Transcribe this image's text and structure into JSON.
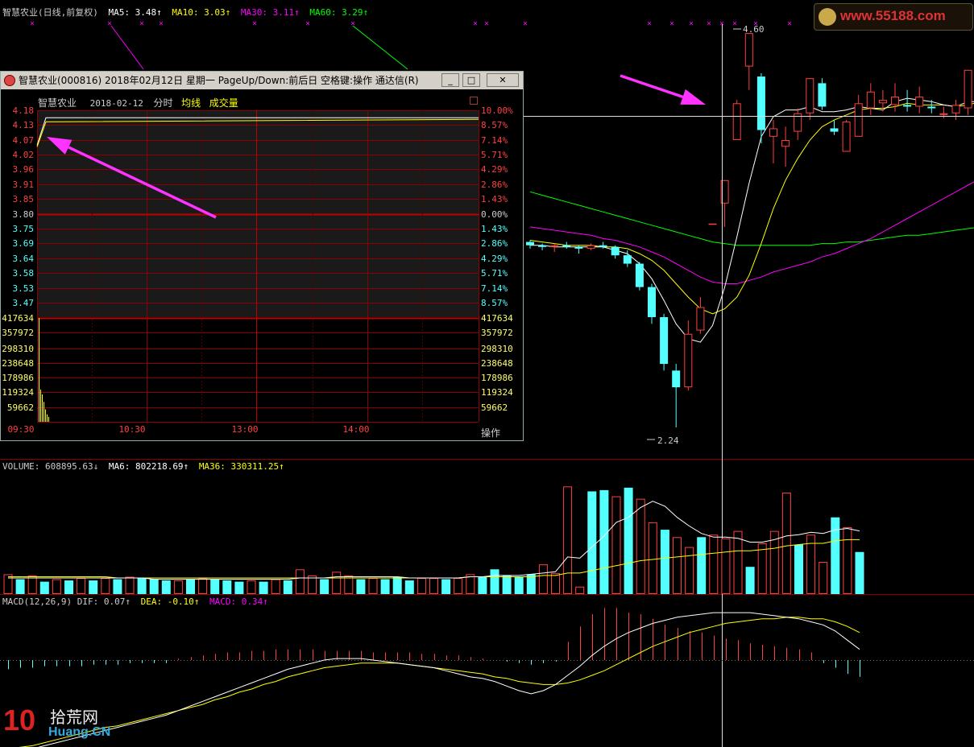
{
  "main": {
    "legend_title": "智慧农业(日线,前复权)",
    "ma5": "MA5: 3.48↑",
    "ma10": "MA10: 3.03↑",
    "ma30": "MA30: 3.11↑",
    "ma60": "MA60: 3.29↑",
    "high_label": "4.60",
    "low_label": "2.24"
  },
  "volume_panel": {
    "label": "VOLUME: 608895.63↓",
    "ma6": "MA6: 802218.69↑",
    "ma36": "MA36: 330311.25↑"
  },
  "macd_panel": {
    "label": "MACD(12,26,9) DIF: 0.07↑",
    "dea": "DEA: -0.10↑",
    "macd": "MACD: 0.34↑"
  },
  "popup": {
    "window_title": "智慧农业(000816) 2018年02月12日 星期一 PageUp/Down:前后日 空格键:操作 通达信(R)",
    "stock_name": "智慧农业",
    "date": "2018-02-12",
    "mode": "分时",
    "avg_line": "均线",
    "volume_label": "成交量",
    "price_ticks": [
      "4.18",
      "4.13",
      "4.07",
      "4.02",
      "3.96",
      "3.91",
      "3.85",
      "3.80",
      "3.75",
      "3.69",
      "3.64",
      "3.58",
      "3.53",
      "3.47"
    ],
    "pct_ticks": [
      "10.00%",
      "8.57%",
      "7.14%",
      "5.71%",
      "4.29%",
      "2.86%",
      "1.43%",
      "0.00%",
      "1.43%",
      "2.86%",
      "4.29%",
      "5.71%",
      "7.14%",
      "8.57%"
    ],
    "vol_ticks": [
      "417634",
      "357972",
      "298310",
      "238648",
      "178986",
      "119324",
      "59662"
    ],
    "time_ticks": [
      "09:30",
      "10:30",
      "13:00",
      "14:00"
    ],
    "action_button": "操作",
    "btn_min": "_",
    "btn_max": "□",
    "btn_close": "✕"
  },
  "watermarks": {
    "top_right": "www.55188.com",
    "bottom_left_cn": "拾荒网",
    "bottom_left_num": "10",
    "bottom_left_en": "Huang.CN"
  },
  "colors": {
    "up": "#ff4040",
    "down": "#54ffff",
    "ma5": "#ffffff",
    "ma10": "#ffff00",
    "ma30": "#ff00ff",
    "ma60": "#00ff00",
    "popup_grid": "#8b0000"
  },
  "chart_data": {
    "type": "candlestick",
    "title": "智慧农业(日线,前复权)",
    "candles": [
      {
        "o": 3.35,
        "h": 3.36,
        "l": 3.31,
        "c": 3.33
      },
      {
        "o": 3.33,
        "h": 3.34,
        "l": 3.3,
        "c": 3.32
      },
      {
        "o": 3.32,
        "h": 3.34,
        "l": 3.29,
        "c": 3.33
      },
      {
        "o": 3.33,
        "h": 3.35,
        "l": 3.31,
        "c": 3.32
      },
      {
        "o": 3.32,
        "h": 3.33,
        "l": 3.28,
        "c": 3.31
      },
      {
        "o": 3.31,
        "h": 3.34,
        "l": 3.3,
        "c": 3.33
      },
      {
        "o": 3.33,
        "h": 3.35,
        "l": 3.31,
        "c": 3.32
      },
      {
        "o": 3.32,
        "h": 3.33,
        "l": 3.25,
        "c": 3.27
      },
      {
        "o": 3.27,
        "h": 3.3,
        "l": 3.2,
        "c": 3.22
      },
      {
        "o": 3.22,
        "h": 3.23,
        "l": 3.06,
        "c": 3.08
      },
      {
        "o": 3.08,
        "h": 3.1,
        "l": 2.86,
        "c": 2.9
      },
      {
        "o": 2.9,
        "h": 2.92,
        "l": 2.58,
        "c": 2.62
      },
      {
        "o": 2.58,
        "h": 2.62,
        "l": 2.24,
        "c": 2.48
      },
      {
        "o": 2.48,
        "h": 2.88,
        "l": 2.46,
        "c": 2.8
      },
      {
        "o": 2.82,
        "h": 3.02,
        "l": 2.8,
        "c": 2.96
      },
      {
        "o": 3.46,
        "h": 3.46,
        "l": 3.46,
        "c": 3.46
      },
      {
        "o": 3.58,
        "h": 3.72,
        "l": 3.44,
        "c": 3.72
      },
      {
        "o": 3.96,
        "h": 4.2,
        "l": 3.96,
        "c": 4.18
      },
      {
        "o": 4.4,
        "h": 4.6,
        "l": 4.26,
        "c": 4.6
      },
      {
        "o": 4.34,
        "h": 4.36,
        "l": 3.94,
        "c": 4.02
      },
      {
        "o": 3.98,
        "h": 4.08,
        "l": 3.82,
        "c": 4.03
      },
      {
        "o": 3.92,
        "h": 4.04,
        "l": 3.8,
        "c": 3.96
      },
      {
        "o": 4.01,
        "h": 4.15,
        "l": 3.96,
        "c": 4.12
      },
      {
        "o": 4.12,
        "h": 4.33,
        "l": 4.08,
        "c": 4.33
      },
      {
        "o": 4.3,
        "h": 4.33,
        "l": 4.14,
        "c": 4.16
      },
      {
        "o": 4.03,
        "h": 4.08,
        "l": 3.99,
        "c": 4.01
      },
      {
        "o": 3.89,
        "h": 4.08,
        "l": 3.89,
        "c": 4.07
      },
      {
        "o": 3.98,
        "h": 4.23,
        "l": 3.98,
        "c": 4.18
      },
      {
        "o": 4.15,
        "h": 4.3,
        "l": 4.11,
        "c": 4.25
      },
      {
        "o": 4.18,
        "h": 4.26,
        "l": 4.13,
        "c": 4.2
      },
      {
        "o": 4.17,
        "h": 4.3,
        "l": 4.13,
        "c": 4.22
      },
      {
        "o": 4.17,
        "h": 4.26,
        "l": 4.13,
        "c": 4.16
      },
      {
        "o": 4.16,
        "h": 4.28,
        "l": 4.12,
        "c": 4.22
      },
      {
        "o": 4.16,
        "h": 4.2,
        "l": 4.12,
        "c": 4.15
      },
      {
        "o": 4.11,
        "h": 4.16,
        "l": 4.09,
        "c": 4.12
      },
      {
        "o": 4.12,
        "h": 4.2,
        "l": 4.08,
        "c": 4.17
      },
      {
        "o": 4.15,
        "h": 4.38,
        "l": 4.11,
        "c": 4.38
      },
      {
        "o": 4.22,
        "h": 4.28,
        "l": 4.12,
        "c": 4.18
      },
      {
        "o": 4.16,
        "h": 4.18,
        "l": 3.94,
        "c": 3.98
      },
      {
        "o": 3.96,
        "h": 4.0,
        "l": 3.86,
        "c": 3.98
      },
      {
        "o": 3.98,
        "h": 3.98,
        "l": 3.88,
        "c": 3.92
      }
    ],
    "ma5": [
      3.33,
      3.33,
      3.32,
      3.32,
      3.32,
      3.32,
      3.32,
      3.3,
      3.28,
      3.22,
      3.13,
      3.0,
      2.86,
      2.77,
      2.75,
      2.85,
      3.08,
      3.38,
      3.7,
      3.98,
      4.1,
      4.14,
      4.14,
      4.16,
      4.13,
      4.13,
      4.14,
      4.16,
      4.15,
      4.14,
      4.19,
      4.21,
      4.2,
      4.19,
      4.17,
      4.16,
      4.19,
      4.19,
      4.16,
      4.11,
      4.05
    ],
    "ma10": [
      3.36,
      3.35,
      3.34,
      3.33,
      3.33,
      3.33,
      3.32,
      3.32,
      3.31,
      3.28,
      3.24,
      3.18,
      3.1,
      3.02,
      2.95,
      2.92,
      2.95,
      3.02,
      3.15,
      3.34,
      3.55,
      3.72,
      3.85,
      3.96,
      4.04,
      4.08,
      4.11,
      4.14,
      4.15,
      4.15,
      4.16,
      4.18,
      4.17,
      4.17,
      4.17,
      4.16,
      4.17,
      4.19,
      4.18,
      4.16,
      4.12
    ],
    "ma30": [
      3.44,
      3.43,
      3.42,
      3.41,
      3.4,
      3.39,
      3.37,
      3.36,
      3.34,
      3.32,
      3.29,
      3.26,
      3.22,
      3.18,
      3.14,
      3.11,
      3.1,
      3.1,
      3.12,
      3.14,
      3.17,
      3.19,
      3.21,
      3.23,
      3.26,
      3.28,
      3.31,
      3.34,
      3.37,
      3.41,
      3.45,
      3.49,
      3.53,
      3.57,
      3.61,
      3.65,
      3.69,
      3.73,
      3.77,
      3.81,
      3.84
    ],
    "ma60": [
      3.65,
      3.63,
      3.61,
      3.59,
      3.57,
      3.55,
      3.53,
      3.51,
      3.49,
      3.47,
      3.45,
      3.43,
      3.41,
      3.39,
      3.37,
      3.35,
      3.34,
      3.33,
      3.33,
      3.33,
      3.33,
      3.33,
      3.33,
      3.33,
      3.34,
      3.34,
      3.35,
      3.35,
      3.36,
      3.37,
      3.38,
      3.39,
      3.39,
      3.4,
      3.41,
      3.42,
      3.43,
      3.44,
      3.45,
      3.46,
      3.47
    ],
    "volume": [
      1.6,
      1.2,
      1.5,
      1.0,
      1.2,
      1.1,
      1.3,
      1.1,
      1.3,
      1.2,
      1.4,
      1.3,
      1.2,
      1.1,
      1.1,
      1.2,
      1.3,
      1.2,
      1.1,
      1.0,
      1.1,
      1.0,
      1.2,
      1.1,
      2.0,
      1.5,
      1.2,
      1.8,
      1.5,
      1.2,
      1.3,
      1.2,
      1.4,
      1.1,
      1.3,
      1.3,
      1.2,
      1.3,
      1.6,
      1.4,
      2.0,
      1.5,
      1.4,
      1.6,
      2.4,
      1.7,
      8.7,
      0.6,
      8.3,
      8.4,
      7.9,
      8.6,
      7.7,
      5.8,
      5.2,
      4.6,
      3.8,
      4.6,
      4.8,
      4.5,
      5.1,
      2.2,
      4.1,
      5.1,
      8.2,
      4.0,
      4.8,
      2.6,
      6.2,
      5.4,
      3.4
    ],
    "volume_scale_note": "",
    "vol_ma6": [
      1.3,
      1.3,
      1.3,
      1.3,
      1.3,
      1.3,
      1.3,
      1.3,
      1.3,
      1.3,
      1.3,
      1.3,
      1.2,
      1.2,
      1.2,
      1.2,
      1.2,
      1.2,
      1.2,
      1.2,
      1.2,
      1.2,
      1.2,
      1.2,
      1.3,
      1.3,
      1.3,
      1.4,
      1.4,
      1.4,
      1.4,
      1.4,
      1.4,
      1.3,
      1.3,
      1.3,
      1.3,
      1.3,
      1.4,
      1.4,
      1.5,
      1.5,
      1.5,
      1.6,
      1.7,
      1.8,
      3.0,
      2.9,
      3.8,
      4.7,
      5.8,
      6.2,
      7.0,
      7.5,
      7.1,
      6.2,
      5.5,
      4.9,
      4.6,
      4.6,
      4.5,
      4.2,
      4.2,
      4.4,
      4.7,
      4.8,
      5.0,
      4.9,
      5.2,
      5.3,
      5.1
    ],
    "vol_ma36": [
      1.4,
      1.4,
      1.4,
      1.4,
      1.4,
      1.4,
      1.4,
      1.4,
      1.4,
      1.3,
      1.3,
      1.3,
      1.3,
      1.3,
      1.3,
      1.3,
      1.3,
      1.3,
      1.3,
      1.3,
      1.3,
      1.3,
      1.3,
      1.3,
      1.3,
      1.3,
      1.3,
      1.3,
      1.3,
      1.3,
      1.3,
      1.3,
      1.3,
      1.3,
      1.3,
      1.3,
      1.3,
      1.3,
      1.4,
      1.4,
      1.4,
      1.4,
      1.4,
      1.4,
      1.5,
      1.5,
      1.7,
      1.7,
      1.9,
      2.1,
      2.3,
      2.5,
      2.7,
      2.8,
      2.9,
      3.0,
      3.1,
      3.2,
      3.3,
      3.4,
      3.5,
      3.5,
      3.6,
      3.7,
      3.9,
      4.0,
      4.1,
      4.1,
      4.3,
      4.4,
      4.4
    ],
    "vol_up": [
      1,
      0,
      1,
      0,
      1,
      0,
      1,
      0,
      1,
      0,
      1,
      0,
      0,
      0,
      1,
      0,
      1,
      0,
      0,
      0,
      1,
      0,
      1,
      0,
      1,
      1,
      0,
      1,
      1,
      0,
      1,
      0,
      0,
      0,
      1,
      1,
      0,
      1,
      1,
      0,
      0,
      0,
      0,
      0,
      1,
      1,
      1,
      1,
      0,
      0,
      1,
      0,
      1,
      1,
      0,
      1,
      1,
      0,
      1,
      1,
      1,
      0,
      1,
      1,
      1,
      0,
      1,
      1,
      0,
      1,
      0
    ],
    "macd_hist": [
      -0.06,
      -0.05,
      -0.05,
      -0.04,
      -0.04,
      -0.04,
      -0.04,
      -0.03,
      -0.03,
      -0.03,
      -0.02,
      -0.02,
      -0.02,
      -0.02,
      0.01,
      0.02,
      0.03,
      0.04,
      0.05,
      0.05,
      0.06,
      0.06,
      0.07,
      0.07,
      0.07,
      0.07,
      0.06,
      0.06,
      0.06,
      0.06,
      0.05,
      0.05,
      0.05,
      0.05,
      0.04,
      0.04,
      0.03,
      0.03,
      0.02,
      0.01,
      0.0,
      -0.01,
      -0.02,
      -0.03,
      -0.02,
      -0.01,
      0.12,
      0.22,
      0.3,
      0.34,
      0.34,
      0.31,
      0.3,
      0.27,
      0.23,
      0.21,
      0.19,
      0.18,
      0.16,
      0.14,
      0.13,
      0.11,
      0.1,
      0.09,
      0.08,
      0.07,
      0.05,
      -0.02,
      -0.05,
      -0.09,
      -0.11
    ],
    "dif": [
      -0.62,
      -0.6,
      -0.58,
      -0.56,
      -0.54,
      -0.52,
      -0.5,
      -0.48,
      -0.46,
      -0.44,
      -0.42,
      -0.4,
      -0.38,
      -0.36,
      -0.33,
      -0.3,
      -0.27,
      -0.24,
      -0.21,
      -0.18,
      -0.15,
      -0.12,
      -0.09,
      -0.06,
      -0.04,
      -0.02,
      0.0,
      0.01,
      0.01,
      0.01,
      0.0,
      -0.01,
      -0.02,
      -0.03,
      -0.04,
      -0.05,
      -0.07,
      -0.09,
      -0.11,
      -0.12,
      -0.14,
      -0.17,
      -0.2,
      -0.22,
      -0.2,
      -0.16,
      -0.1,
      -0.04,
      0.03,
      0.09,
      0.14,
      0.18,
      0.21,
      0.24,
      0.26,
      0.28,
      0.29,
      0.3,
      0.31,
      0.31,
      0.31,
      0.31,
      0.3,
      0.29,
      0.28,
      0.27,
      0.25,
      0.23,
      0.19,
      0.13,
      0.07
    ],
    "dea": [
      -0.58,
      -0.57,
      -0.56,
      -0.54,
      -0.52,
      -0.5,
      -0.48,
      -0.46,
      -0.44,
      -0.43,
      -0.41,
      -0.39,
      -0.37,
      -0.35,
      -0.33,
      -0.31,
      -0.29,
      -0.26,
      -0.24,
      -0.21,
      -0.19,
      -0.16,
      -0.14,
      -0.11,
      -0.09,
      -0.07,
      -0.05,
      -0.04,
      -0.03,
      -0.02,
      -0.02,
      -0.02,
      -0.02,
      -0.03,
      -0.04,
      -0.05,
      -0.06,
      -0.07,
      -0.08,
      -0.09,
      -0.11,
      -0.12,
      -0.14,
      -0.15,
      -0.16,
      -0.16,
      -0.15,
      -0.13,
      -0.1,
      -0.07,
      -0.03,
      0.01,
      0.05,
      0.09,
      0.12,
      0.15,
      0.18,
      0.2,
      0.22,
      0.24,
      0.25,
      0.26,
      0.27,
      0.27,
      0.28,
      0.28,
      0.27,
      0.27,
      0.25,
      0.22,
      0.18
    ],
    "ylim_price": [
      2.1,
      4.75
    ],
    "intraday": {
      "type": "line",
      "ylim": [
        3.44,
        4.21
      ],
      "price_pct_of_day": [
        0.0,
        0.02,
        1.0
      ],
      "price": [
        4.07,
        4.18,
        4.18
      ],
      "avg": [
        4.07,
        4.17,
        4.18
      ],
      "volume": [
        417634,
        130000,
        110000,
        80000,
        50000,
        30000,
        20000
      ]
    }
  }
}
